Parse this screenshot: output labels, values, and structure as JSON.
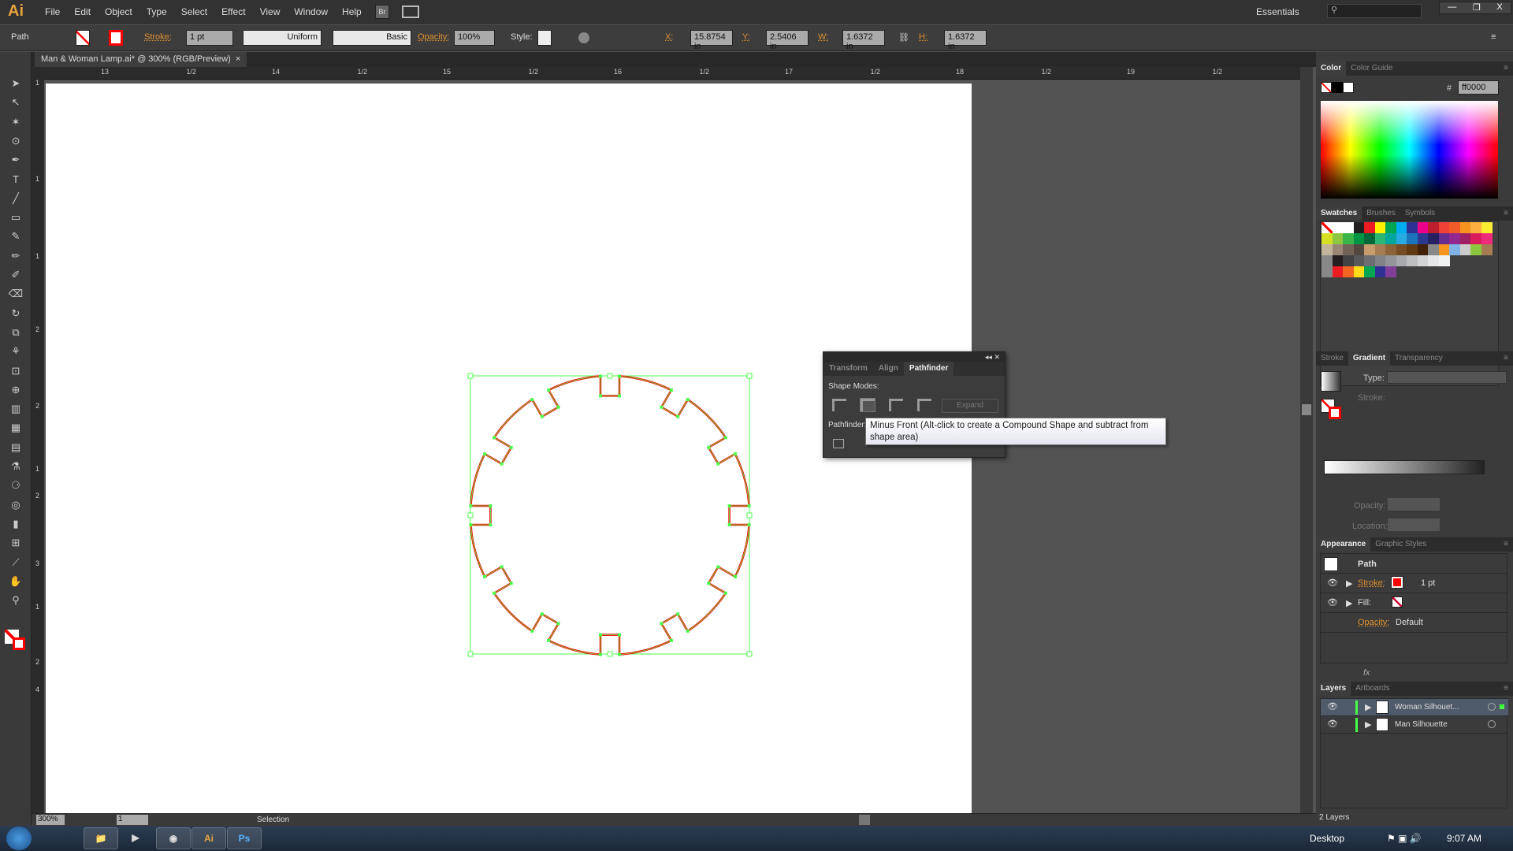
{
  "app": {
    "logo": "Ai",
    "menus": [
      "File",
      "Edit",
      "Object",
      "Type",
      "Select",
      "Effect",
      "View",
      "Window",
      "Help"
    ],
    "workspace": "Essentials",
    "search_placeholder": ""
  },
  "control": {
    "selection": "Path",
    "stroke_label": "Stroke:",
    "stroke_weight": "1 pt",
    "profile": "Uniform",
    "brush": "Basic",
    "opacity_label": "Opacity:",
    "opacity": "100%",
    "style_label": "Style:",
    "x_label": "X:",
    "x": "15.8754 in",
    "y_label": "Y:",
    "y": "2.5406 in",
    "w_label": "W:",
    "w": "1.6372 in",
    "h_label": "H:",
    "h": "1.6372 in"
  },
  "document": {
    "tab": "Man & Woman Lamp.ai* @ 300% (RGB/Preview)",
    "close": "×"
  },
  "ruler": {
    "h": [
      "13",
      "1/2",
      "14",
      "1/2",
      "15",
      "1/2",
      "16",
      "1/2",
      "17",
      "1/2",
      "18",
      "1/2",
      "19",
      "1/2"
    ],
    "v": [
      "1",
      "1",
      "1",
      "2",
      "2",
      "1",
      "2",
      "3",
      "1",
      "2",
      "4"
    ]
  },
  "canvas": {
    "shape_stroke": "#ff0000",
    "selection_color": "#4cff4c",
    "notches": 12
  },
  "pathfinder": {
    "tabs": [
      "Transform",
      "Align",
      "Pathfinder"
    ],
    "active": 2,
    "shape_modes": "Shape Modes:",
    "expand": "Expand",
    "pathfinders": "Pathfinder:",
    "tooltip": "Minus Front (Alt-click to create a Compound Shape and subtract from shape area)"
  },
  "color_panel": {
    "tabs": [
      "Color",
      "Color Guide"
    ],
    "hex_label": "#",
    "hex": "ff0000"
  },
  "swatches_panel": {
    "tabs": [
      "Swatches",
      "Brushes",
      "Symbols"
    ],
    "rows": [
      [
        "none",
        "reg",
        "#ffffff",
        "#231f20",
        "#ed1c24",
        "#fff200",
        "#00a651",
        "#00aeef",
        "#2e3192",
        "#ec008c",
        "#be1e2d",
        "#ef4136",
        "#f15a29",
        "#f7941d",
        "#fbb040",
        "#f9ed32"
      ],
      [
        "#d7df23",
        "#8dc63f",
        "#39b54a",
        "#009444",
        "#006838",
        "#2bb673",
        "#00a79d",
        "#27aae1",
        "#1c75bc",
        "#2b3990",
        "#262262",
        "#662d91",
        "#92278f",
        "#9e1f63",
        "#da1c5c",
        "#ee2a7b"
      ],
      [
        "#c2b59b",
        "#998675",
        "#736357",
        "#534741",
        "#c69c6d",
        "#a67c52",
        "#8c6239",
        "#754c24",
        "#603913",
        "#42210b",
        "#888888",
        "#f7941d",
        "#7fb2e5",
        "#cccccc",
        "#8dc63f",
        "#a67c52"
      ],
      [
        "folder",
        "#231f20",
        "#414042",
        "#58595b",
        "#6d6e71",
        "#808285",
        "#939598",
        "#a7a9ac",
        "#bcbec0",
        "#d1d3d4",
        "#e6e7e8",
        "#f1f2f2"
      ],
      [
        "folder",
        "#ed1c24",
        "#f26522",
        "#ffde17",
        "#00a651",
        "#2e3192",
        "#7f3f98"
      ]
    ]
  },
  "gradient_panel": {
    "tabs": [
      "Stroke",
      "Gradient",
      "Transparency"
    ],
    "type_label": "Type:",
    "stroke_label": "Stroke:",
    "opacity_label": "Opacity:",
    "location_label": "Location:"
  },
  "appearance": {
    "tabs": [
      "Appearance",
      "Graphic Styles"
    ],
    "title": "Path",
    "stroke_label": "Stroke:",
    "stroke_value": "1 pt",
    "fill_label": "Fill:",
    "opacity_label": "Opacity:",
    "opacity_value": "Default",
    "fx": "fx"
  },
  "layers": {
    "tabs": [
      "Layers",
      "Artboards"
    ],
    "items": [
      "Woman Silhouet...",
      "Man Silhouette"
    ],
    "count": "2 Layers"
  },
  "status": {
    "zoom": "300%",
    "artboard": "1",
    "tool": "Selection"
  },
  "taskbar": {
    "desktop": "Desktop",
    "time": "9:07 AM",
    "apps": [
      "Ai",
      "Ps"
    ]
  }
}
